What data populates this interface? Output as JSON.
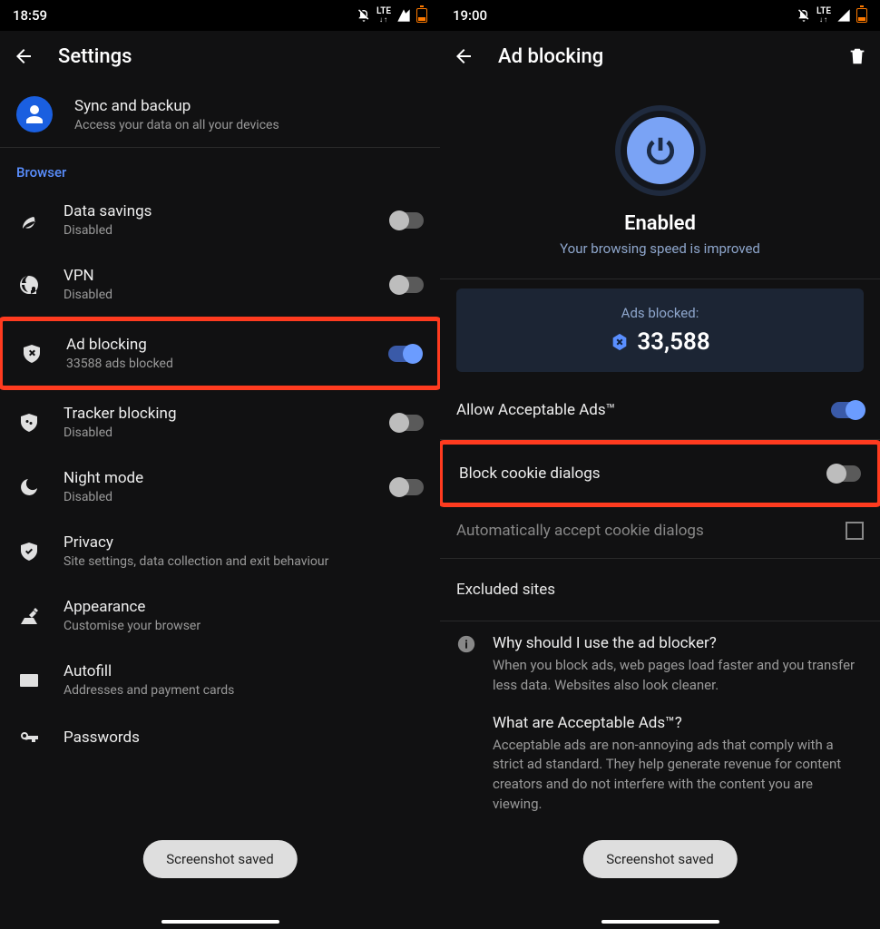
{
  "left": {
    "time": "18:59",
    "title": "Settings",
    "sync": {
      "title": "Sync and backup",
      "sub": "Access your data on all your devices"
    },
    "sectionBrowser": "Browser",
    "items": {
      "data_savings": {
        "title": "Data savings",
        "sub": "Disabled"
      },
      "vpn": {
        "title": "VPN",
        "sub": "Disabled"
      },
      "ad_blocking": {
        "title": "Ad blocking",
        "sub": "33588 ads blocked"
      },
      "tracker": {
        "title": "Tracker blocking",
        "sub": "Disabled"
      },
      "night": {
        "title": "Night mode",
        "sub": "Disabled"
      },
      "privacy": {
        "title": "Privacy",
        "sub": "Site settings, data collection and exit behaviour"
      },
      "appearance": {
        "title": "Appearance",
        "sub": "Customise your browser"
      },
      "autofill": {
        "title": "Autofill",
        "sub": "Addresses and payment cards"
      },
      "passwords": {
        "title": "Passwords"
      }
    },
    "toast": "Screenshot saved"
  },
  "right": {
    "time": "19:00",
    "title": "Ad blocking",
    "enabled": {
      "title": "Enabled",
      "sub": "Your browsing speed is improved"
    },
    "stat": {
      "label": "Ads blocked:",
      "count": "33,588"
    },
    "allowAds": "Allow Acceptable Ads™",
    "blockCookie": "Block cookie dialogs",
    "autoAccept": "Automatically accept cookie dialogs",
    "excluded": "Excluded sites",
    "info1": {
      "q": "Why should I use the ad blocker?",
      "a": "When you block ads, web pages load faster and you transfer less data. Websites also look cleaner."
    },
    "info2": {
      "q": "What are Acceptable Ads™?",
      "a": "Acceptable ads are non-annoying ads that comply with a strict ad standard. They help generate revenue for content creators and do not interfere with the content you are viewing."
    },
    "toast": "Screenshot saved"
  },
  "lte": "LTE"
}
